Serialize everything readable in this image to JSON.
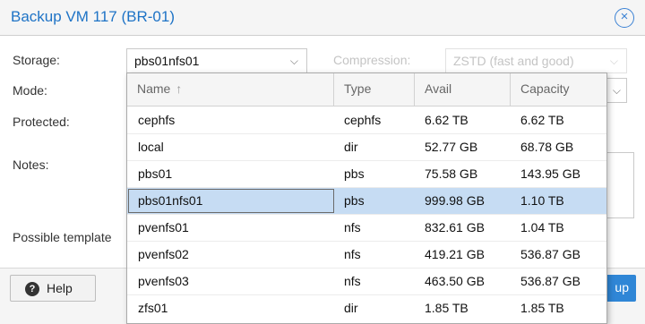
{
  "dialog": {
    "title": "Backup VM 117 (BR-01)",
    "close_glyph": "×"
  },
  "form": {
    "storage_label": "Storage:",
    "storage_value": "pbs01nfs01",
    "mode_label": "Mode:",
    "protected_label": "Protected:",
    "notes_label": "Notes:",
    "template_label": "Possible template",
    "compression_label": "Compression:",
    "compression_value": "ZSTD (fast and good)",
    "chevron": "⌵"
  },
  "grid": {
    "columns": [
      {
        "label": "Name",
        "sort": "↑"
      },
      {
        "label": "Type"
      },
      {
        "label": "Avail"
      },
      {
        "label": "Capacity"
      }
    ],
    "rows": [
      {
        "name": "cephfs",
        "type": "cephfs",
        "avail": "6.62 TB",
        "capacity": "6.62 TB",
        "selected": false
      },
      {
        "name": "local",
        "type": "dir",
        "avail": "52.77 GB",
        "capacity": "68.78 GB",
        "selected": false
      },
      {
        "name": "pbs01",
        "type": "pbs",
        "avail": "75.58 GB",
        "capacity": "143.95 GB",
        "selected": false
      },
      {
        "name": "pbs01nfs01",
        "type": "pbs",
        "avail": "999.98 GB",
        "capacity": "1.10 TB",
        "selected": true
      },
      {
        "name": "pvenfs01",
        "type": "nfs",
        "avail": "832.61 GB",
        "capacity": "1.04 TB",
        "selected": false
      },
      {
        "name": "pvenfs02",
        "type": "nfs",
        "avail": "419.21 GB",
        "capacity": "536.87 GB",
        "selected": false
      },
      {
        "name": "pvenfs03",
        "type": "nfs",
        "avail": "463.50 GB",
        "capacity": "536.87 GB",
        "selected": false
      },
      {
        "name": "zfs01",
        "type": "dir",
        "avail": "1.85 TB",
        "capacity": "1.85 TB",
        "selected": false
      }
    ]
  },
  "footer": {
    "help_label": "Help",
    "help_icon": "?",
    "backup_label_visible": "up"
  },
  "colors": {
    "accent": "#1e73c6",
    "selected_row": "#c6dcf3",
    "primary_button": "#2f86d6"
  }
}
